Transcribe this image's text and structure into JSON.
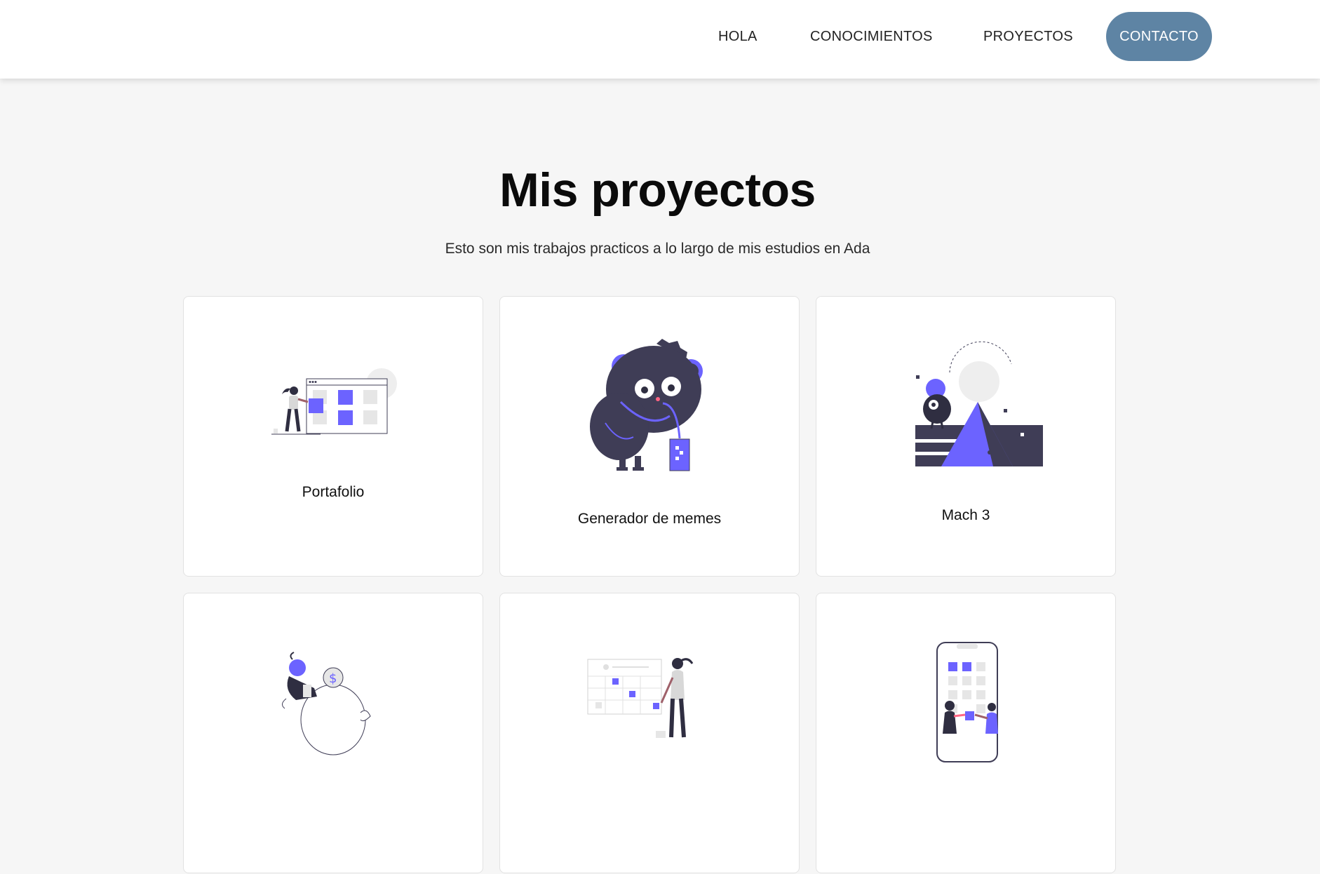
{
  "nav": {
    "items": [
      "HOLA",
      "CONOCIMIENTOS",
      "PROYECTOS"
    ],
    "contact_label": "CONTACTO"
  },
  "colors": {
    "accent": "#6c63ff",
    "dark": "#3f3d56",
    "contact_button": "#5e84a4",
    "background": "#f6f6f6"
  },
  "main": {
    "title": "Mis proyectos",
    "subtitle": "Esto son mis trabajos practicos a lo largo de mis estudios en Ada"
  },
  "projects": [
    {
      "label": "Portafolio",
      "icon": "dashboard-illustration"
    },
    {
      "label": "Generador de memes",
      "icon": "monster-drinking-illustration"
    },
    {
      "label": "Mach 3",
      "icon": "monster-pyramid-illustration"
    },
    {
      "label": "",
      "icon": "piggy-bank-illustration"
    },
    {
      "label": "",
      "icon": "calendar-board-illustration"
    },
    {
      "label": "",
      "icon": "mobile-app-illustration"
    }
  ]
}
